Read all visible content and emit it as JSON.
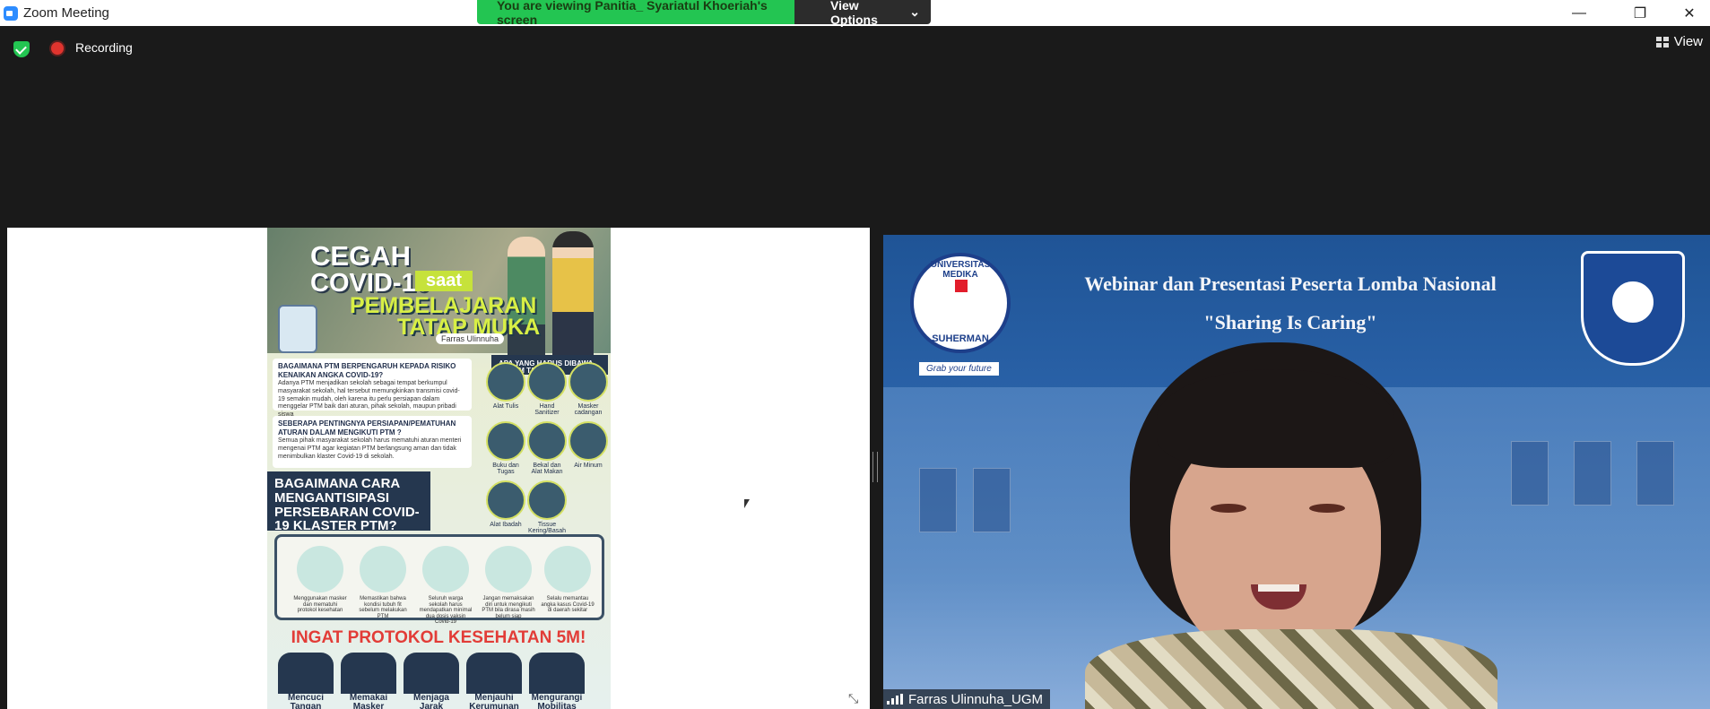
{
  "window": {
    "title": "Zoom Meeting",
    "controls": {
      "minimize": "—",
      "restore": "❐",
      "close": "✕"
    }
  },
  "share_banner": {
    "text": "You are viewing Panitia_ Syariatul Khoeriah's screen",
    "view_options_label": "View Options",
    "view_options_caret": "⌄"
  },
  "toolbar": {
    "recording_label": "Recording",
    "view_label": "View"
  },
  "shared_screen": {
    "poster": {
      "headline_1": "CEGAH",
      "headline_2": "COVID-19",
      "headline_saat": "saat",
      "headline_3": "PEMBELAJARAN",
      "headline_4": "TATAP MUKA",
      "author": "Farras Ulinnuha",
      "q1_title": "BAGAIMANA PTM BERPENGARUH KEPADA RISIKO KENAIKAN ANGKA COVID-19?",
      "q1_body": "Adanya PTM menjadikan sekolah sebagai tempat berkumpul masyarakat sekolah, hal tersebut memungkinkan transmisi covid-19 semakin mudah, oleh karena itu perlu persiapan dalam menggelar PTM baik dari aturan, pihak sekolah, maupun pribadi siswa",
      "q2_title": "SEBERAPA PENTINGNYA PERSIAPAN/PEMATUHAN ATURAN DALAM MENGIKUTI PTM ?",
      "q2_body": "Semua pihak masyarakat sekolah harus mematuhi aturan menteri mengenai PTM agar kegiatan PTM berlangsung aman dan tidak menimbulkan klaster Covid-19 di sekolah.",
      "q3_title": "APA YANG HARUS DIBAWA DALAM TAS?",
      "items": [
        "Alat Tulis",
        "Hand Sanitizer",
        "Masker cadangan",
        "Buku dan Tugas",
        "Bekal dan Alat Makan",
        "Air Minum",
        "Alat Ibadah",
        "Tissue Kering/Basah"
      ],
      "q4_title": "BAGAIMANA CARA MENGANTISIPASI PERSEBARAN COVID-19 KLASTER PTM?",
      "tips": [
        "Menggunakan masker dan mematuhi protokol kesehatan",
        "Memastikan bahwa kondisi tubuh fit sebelum melakukan PTM",
        "Seluruh warga sekolah harus mendapatkan minimal dua dosis vaksin Covid-19",
        "Jangan memaksakan diri untuk mengikuti PTM bila dirasa masih belum siap",
        "Selalu memantau angka kasus Covid-19 di daerah sekitar"
      ],
      "protocol_title": "INGAT PROTOKOL KESEHATAN 5M!",
      "protocols": [
        "Mencuci Tangan",
        "Memakai Masker",
        "Menjaga Jarak",
        "Menjauhi Kerumunan",
        "Mengurangi Mobilitas"
      ]
    },
    "expand_icon": "⤡"
  },
  "video": {
    "banner_line_1": "Webinar dan Presentasi Peserta Lomba Nasional",
    "banner_line_2": "\"Sharing Is Caring\"",
    "logo_left_top": "UNIVERSITAS MEDIKA",
    "logo_left_bottom": "SUHERMAN",
    "logo_left_tagline": "Grab your future",
    "participant_name": "Farras Ulinnuha_UGM"
  }
}
